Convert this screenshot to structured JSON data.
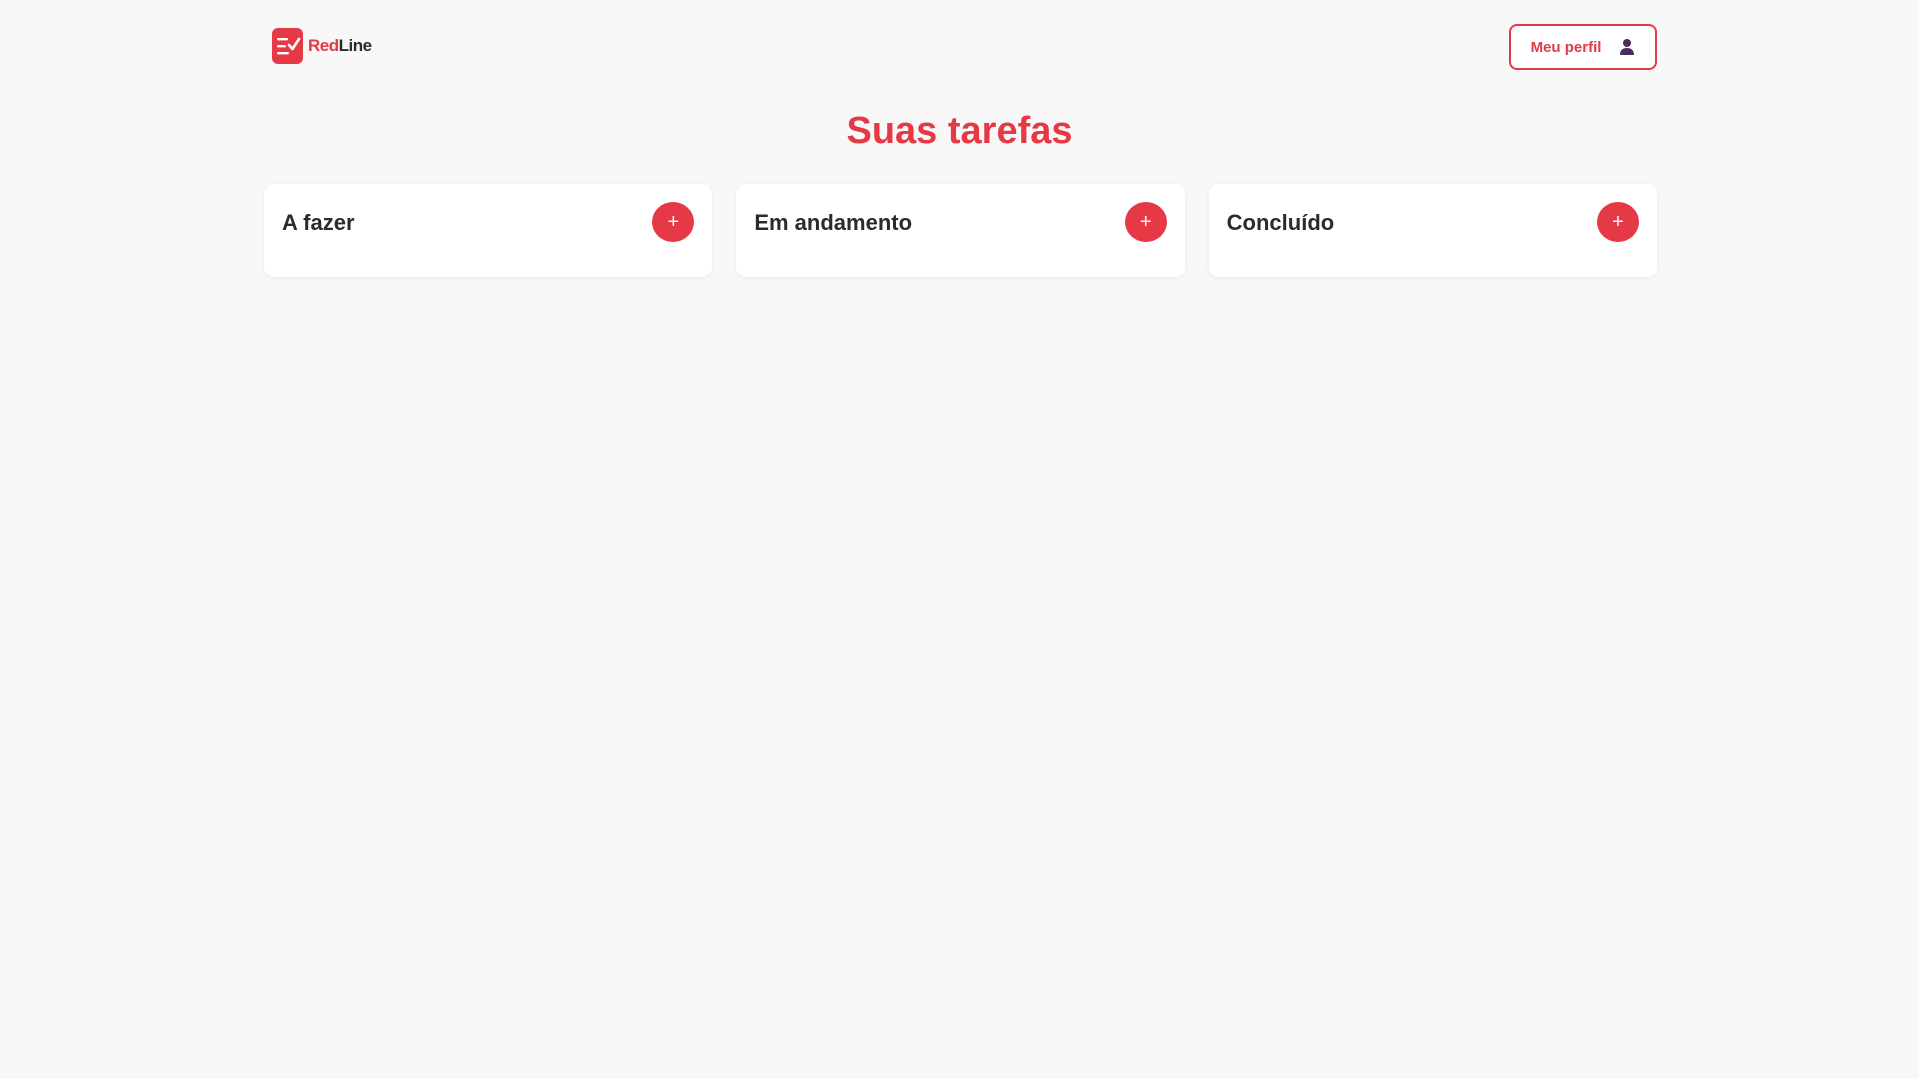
{
  "header": {
    "logo": {
      "text_part1": "Red",
      "text_part2": "Line",
      "icon": "task-list-icon"
    },
    "profile_button": {
      "label": "Meu perfil",
      "icon": "user-icon"
    }
  },
  "main": {
    "title": "Suas tarefas",
    "columns": [
      {
        "title": "A fazer",
        "add_icon": "+"
      },
      {
        "title": "Em andamento",
        "add_icon": "+"
      },
      {
        "title": "Concluído",
        "add_icon": "+"
      }
    ]
  },
  "colors": {
    "accent": "#e63946",
    "background": "#f8f8f8",
    "card": "#ffffff",
    "text_dark": "#2b2b2b",
    "user_icon": "#4a2c5e"
  }
}
